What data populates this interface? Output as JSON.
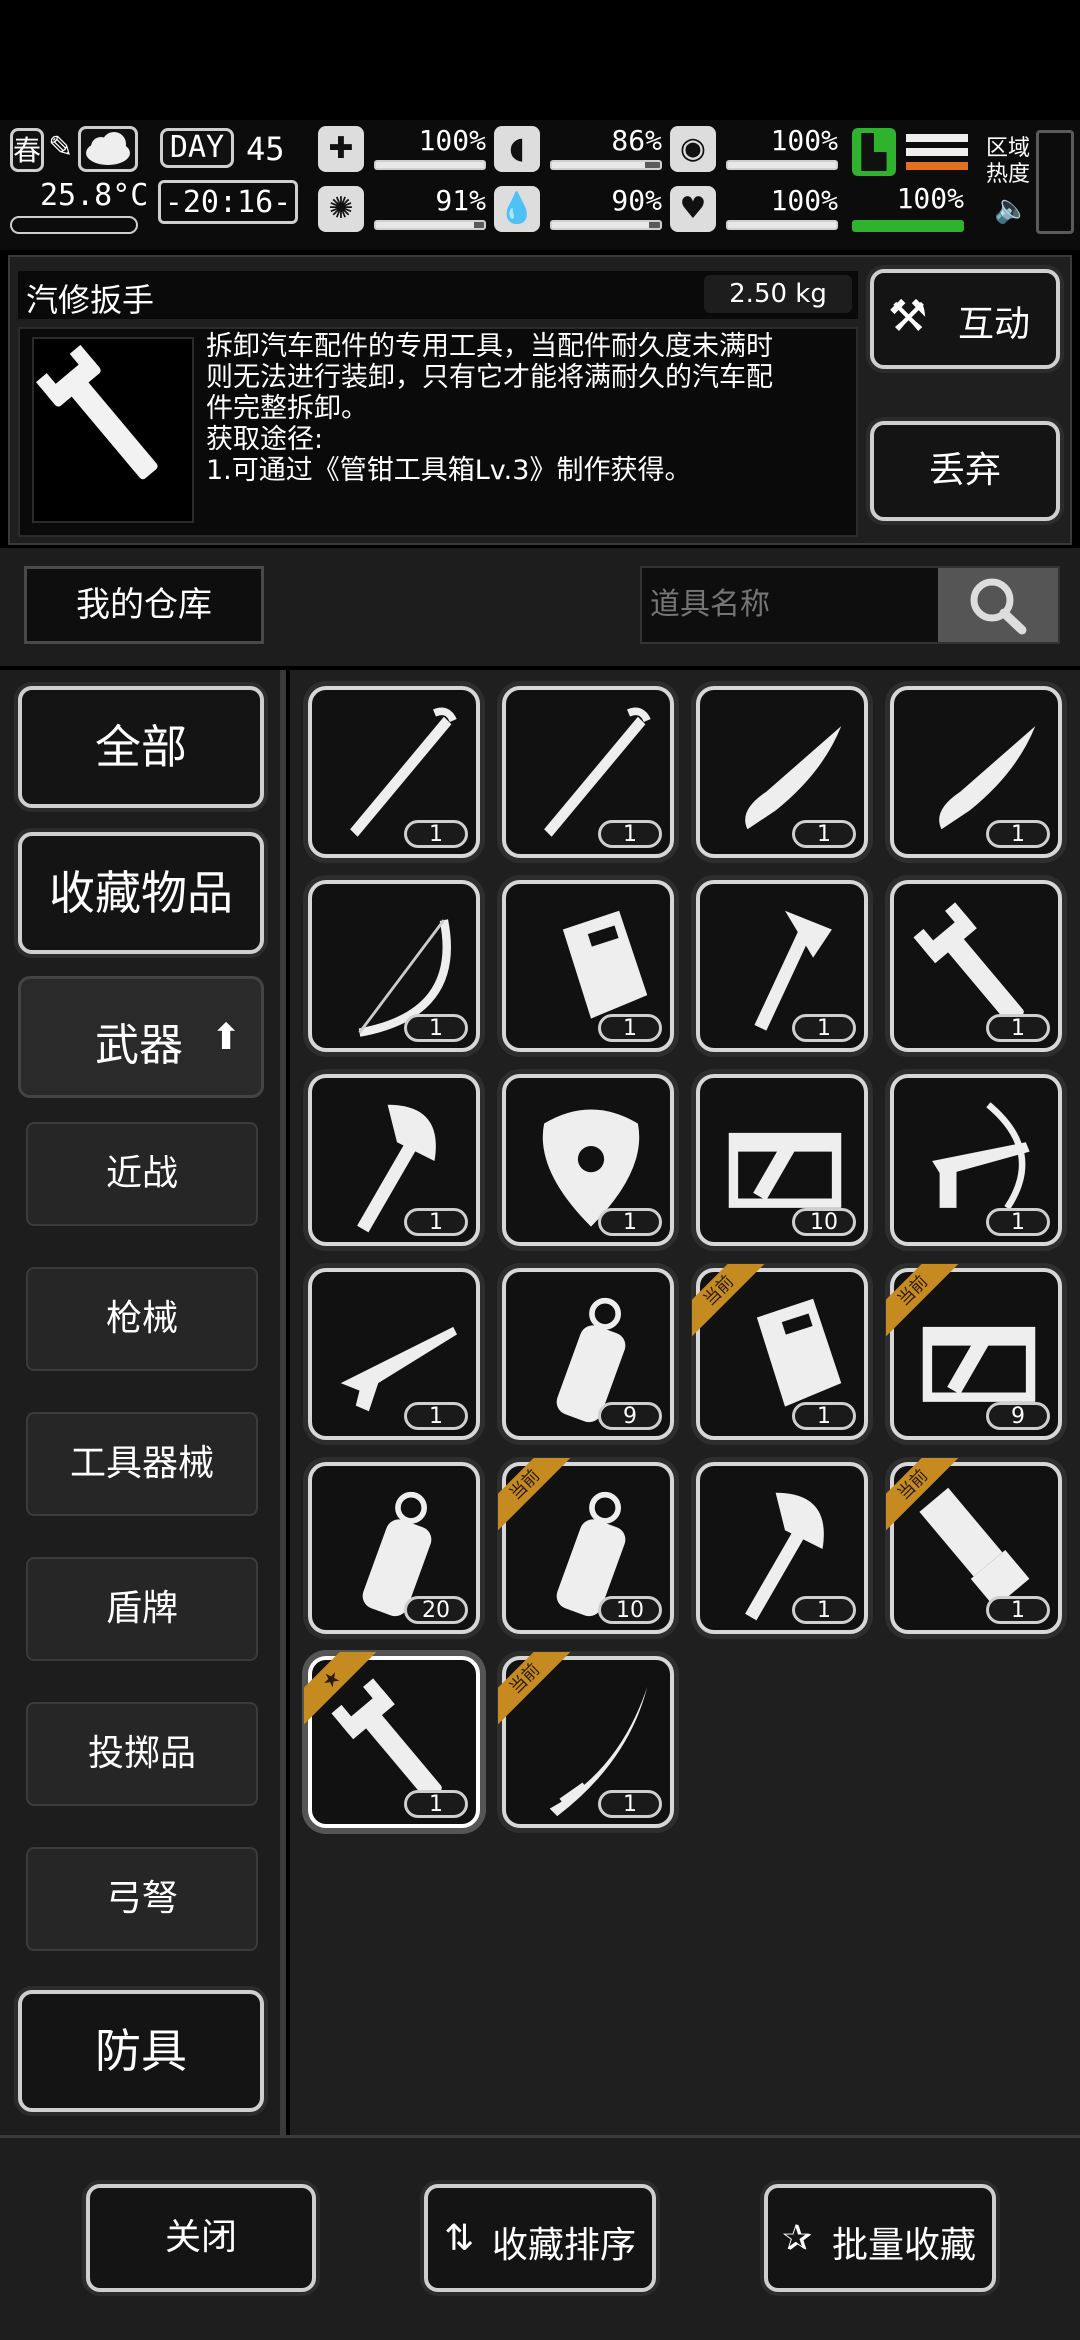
{
  "status": {
    "season": "春",
    "temperature": "25.8°C",
    "day_label": "DAY",
    "day_number": "45",
    "time": "-20:16-",
    "stats": [
      {
        "icon": "medkit-icon",
        "value": "100%",
        "fill": 1.0
      },
      {
        "icon": "stomach-icon",
        "value": "86%",
        "fill": 0.86
      },
      {
        "icon": "pill-icon",
        "value": "100%",
        "fill": 1.0
      },
      {
        "icon": "brain-icon",
        "value": "91%",
        "fill": 0.91
      },
      {
        "icon": "water-drop-icon",
        "value": "90%",
        "fill": 0.9
      },
      {
        "icon": "heart-icon",
        "value": "100%",
        "fill": 1.0
      }
    ],
    "stamina_value": "100%",
    "zone_heat_label_1": "区域",
    "zone_heat_label_2": "热度"
  },
  "detail": {
    "item_name": "汽修扳手",
    "weight": "2.50 kg",
    "description_lines": [
      "拆卸汽车配件的专用工具，当配件耐久度未满时",
      "则无法进行装卸，只有它才能将满耐久的汽车配",
      "件完整拆卸。",
      "获取途径:",
      "1.可通过《管钳工具箱Lv.3》制作获得。"
    ],
    "interact_label": "互动",
    "discard_label": "丢弃"
  },
  "warehouse": {
    "title": "我的仓库",
    "search_placeholder": "道具名称"
  },
  "categories": {
    "all": "全部",
    "favorites": "收藏物品",
    "weapons": "武器",
    "sub": [
      "近战",
      "枪械",
      "工具器械",
      "盾牌",
      "投掷品",
      "弓弩"
    ],
    "armor": "防具"
  },
  "ribbon_text": "当前",
  "items": [
    {
      "icon": "crowbar-icon",
      "count": "1"
    },
    {
      "icon": "crowbar-icon",
      "count": "1"
    },
    {
      "icon": "folding-knife-icon",
      "count": "1"
    },
    {
      "icon": "folding-knife-icon",
      "count": "1"
    },
    {
      "icon": "bow-icon",
      "count": "1"
    },
    {
      "icon": "riot-shield-icon",
      "count": "1"
    },
    {
      "icon": "hatchet-icon",
      "count": "1"
    },
    {
      "icon": "wrench-icon",
      "count": "1"
    },
    {
      "icon": "axe-icon",
      "count": "1"
    },
    {
      "icon": "round-shield-icon",
      "count": "1"
    },
    {
      "icon": "ammo-crate-icon",
      "count": "10"
    },
    {
      "icon": "crossbow-icon",
      "count": "1"
    },
    {
      "icon": "rifle-icon",
      "count": "1"
    },
    {
      "icon": "grenade-icon",
      "count": "9"
    },
    {
      "icon": "riot-shield-icon",
      "count": "1",
      "equipped": true
    },
    {
      "icon": "ammo-crate-icon",
      "count": "9",
      "equipped": true
    },
    {
      "icon": "grenade-icon",
      "count": "20"
    },
    {
      "icon": "grenade-icon",
      "count": "10",
      "equipped": true
    },
    {
      "icon": "axe-icon",
      "count": "1"
    },
    {
      "icon": "minigun-icon",
      "count": "1",
      "equipped": true
    },
    {
      "icon": "wrench-icon",
      "count": "1",
      "favorite": true,
      "selected": true
    },
    {
      "icon": "katana-icon",
      "count": "1",
      "equipped": true
    }
  ],
  "bottom": {
    "close_label": "关闭",
    "sort_label": "收藏排序",
    "batch_label": "批量收藏"
  },
  "colors": {
    "ribbon": "#c58a20",
    "stamina": "#2fb32f",
    "heat_orange": "#e07020"
  }
}
